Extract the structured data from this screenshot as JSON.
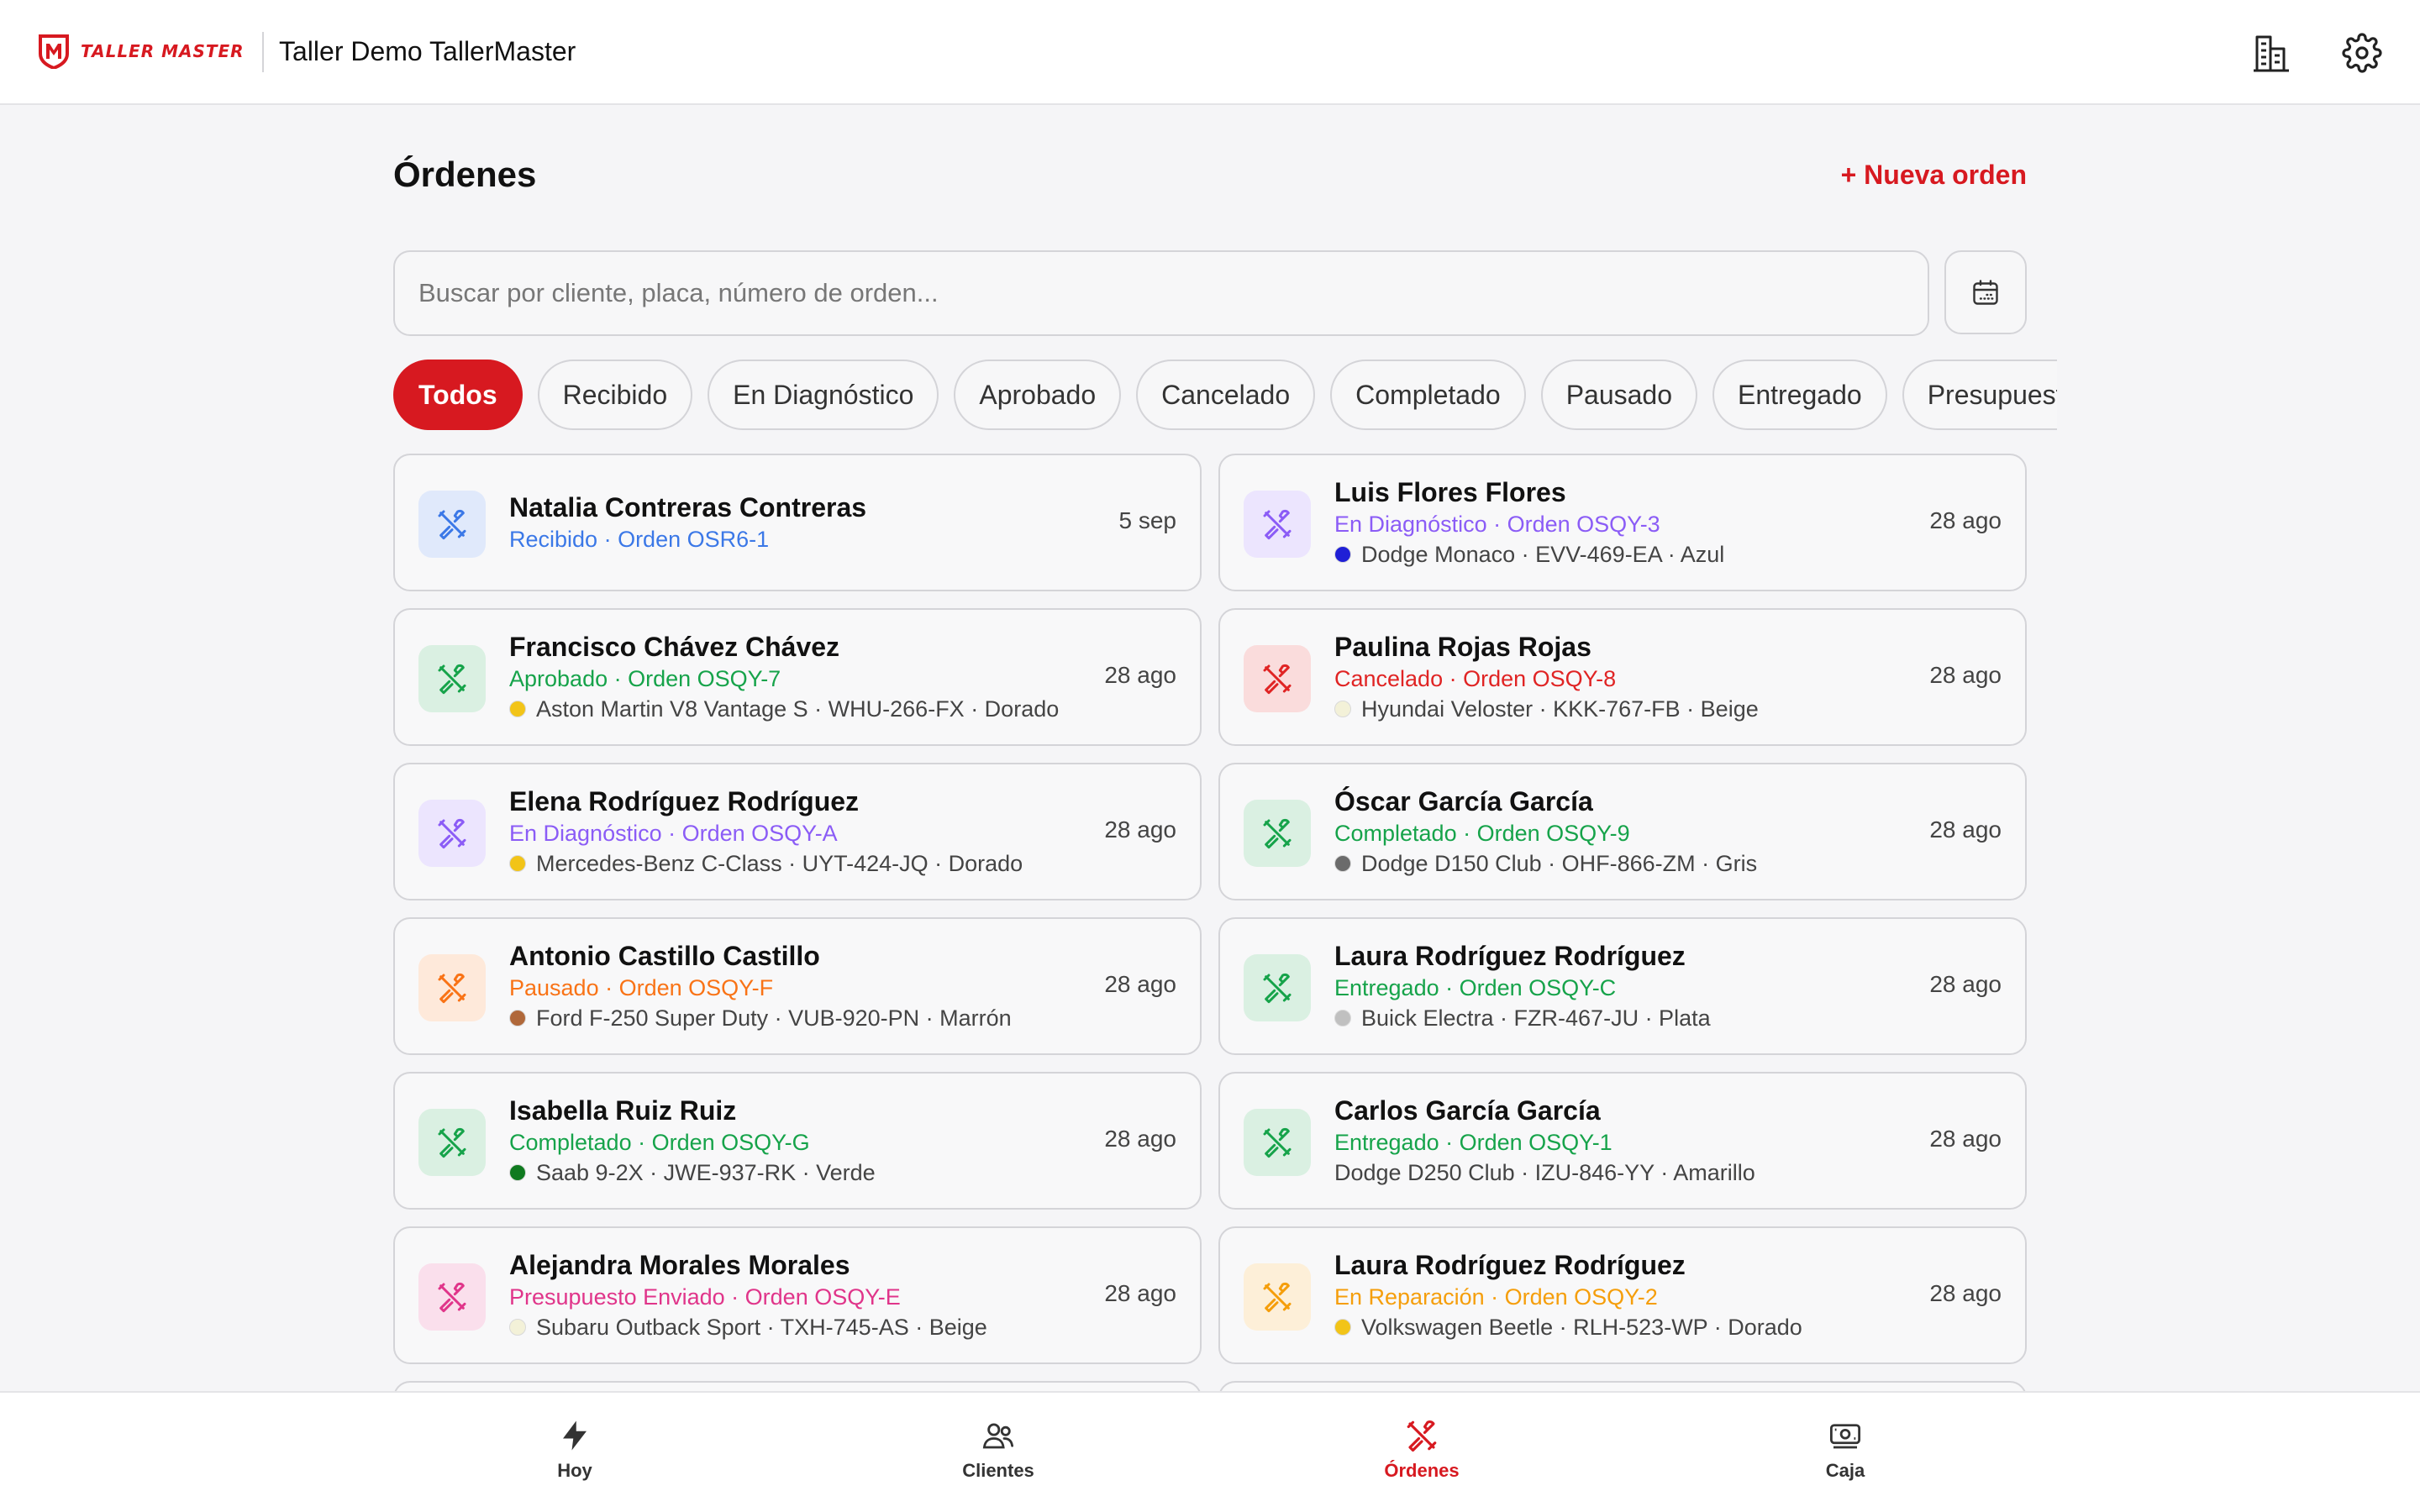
{
  "header": {
    "logo_text": "TALLER MASTER",
    "shop_name": "Taller Demo TallerMaster",
    "icons": [
      "building-icon",
      "gear-icon"
    ]
  },
  "page": {
    "title": "Órdenes",
    "new_order_label": "+ Nueva orden",
    "search_placeholder": "Buscar por cliente, placa, número de orden..."
  },
  "filters": [
    "Todos",
    "Recibido",
    "En Diagnóstico",
    "Aprobado",
    "Cancelado",
    "Completado",
    "Pausado",
    "Entregado",
    "Presupuesto Enviado"
  ],
  "active_filter": "Todos",
  "status_colors": {
    "Recibido": "#3b78e7",
    "En Diagnóstico": "#8b5cf6",
    "Aprobado": "#16a34a",
    "Cancelado": "#e02424",
    "Completado": "#16a34a",
    "Pausado": "#f97316",
    "Entregado": "#16a34a",
    "Presupuesto Enviado": "#e0358a",
    "En Reparación": "#f59e0b"
  },
  "orders": [
    {
      "client": "Natalia Contreras Contreras",
      "status": "Recibido",
      "order": "Orden OSR6-1",
      "vehicle": "",
      "color_hex": "",
      "date": "5 sep"
    },
    {
      "client": "Luis Flores Flores",
      "status": "En Diagnóstico",
      "order": "Orden OSQY-3",
      "vehicle": "Dodge Monaco · EVV-469-EA · Azul",
      "color_hex": "#1f1fd6",
      "date": "28 ago"
    },
    {
      "client": "Francisco Chávez Chávez",
      "status": "Aprobado",
      "order": "Orden OSQY-7",
      "vehicle": "Aston Martin V8 Vantage S · WHU-266-FX · Dorado",
      "color_hex": "#f2c418",
      "date": "28 ago"
    },
    {
      "client": "Paulina Rojas Rojas",
      "status": "Cancelado",
      "order": "Orden OSQY-8",
      "vehicle": "Hyundai Veloster · KKK-767-FB · Beige",
      "color_hex": "#f3f1d8",
      "date": "28 ago"
    },
    {
      "client": "Elena Rodríguez Rodríguez",
      "status": "En Diagnóstico",
      "order": "Orden OSQY-A",
      "vehicle": "Mercedes-Benz C-Class · UYT-424-JQ · Dorado",
      "color_hex": "#f2c418",
      "date": "28 ago"
    },
    {
      "client": "Óscar García García",
      "status": "Completado",
      "order": "Orden OSQY-9",
      "vehicle": "Dodge D150 Club · OHF-866-ZM · Gris",
      "color_hex": "#6b6b6b",
      "date": "28 ago"
    },
    {
      "client": "Antonio Castillo Castillo",
      "status": "Pausado",
      "order": "Orden OSQY-F",
      "vehicle": "Ford F-250 Super Duty · VUB-920-PN · Marrón",
      "color_hex": "#b0683a",
      "date": "28 ago"
    },
    {
      "client": "Laura Rodríguez Rodríguez",
      "status": "Entregado",
      "order": "Orden OSQY-C",
      "vehicle": "Buick Electra · FZR-467-JU · Plata",
      "color_hex": "#c0c0c0",
      "date": "28 ago"
    },
    {
      "client": "Isabella Ruiz Ruiz",
      "status": "Completado",
      "order": "Orden OSQY-G",
      "vehicle": "Saab 9-2X · JWE-937-RK · Verde",
      "color_hex": "#0f7a1f",
      "date": "28 ago"
    },
    {
      "client": "Carlos García García",
      "status": "Entregado",
      "order": "Orden OSQY-1",
      "vehicle": "Dodge D250 Club · IZU-846-YY · Amarillo",
      "color_hex": "",
      "date": "28 ago"
    },
    {
      "client": "Alejandra Morales Morales",
      "status": "Presupuesto Enviado",
      "order": "Orden OSQY-E",
      "vehicle": "Subaru Outback Sport · TXH-745-AS · Beige",
      "color_hex": "#f3f1d8",
      "date": "28 ago"
    },
    {
      "client": "Laura Rodríguez Rodríguez",
      "status": "En Reparación",
      "order": "Orden OSQY-2",
      "vehicle": "Volkswagen Beetle · RLH-523-WP · Dorado",
      "color_hex": "#f2c418",
      "date": "28 ago"
    }
  ],
  "bottom_nav": [
    {
      "label": "Hoy",
      "icon": "lightning-icon"
    },
    {
      "label": "Clientes",
      "icon": "users-icon"
    },
    {
      "label": "Órdenes",
      "icon": "tools-icon"
    },
    {
      "label": "Caja",
      "icon": "cash-icon"
    }
  ],
  "active_nav": "Órdenes",
  "accent_color": "#d71920"
}
